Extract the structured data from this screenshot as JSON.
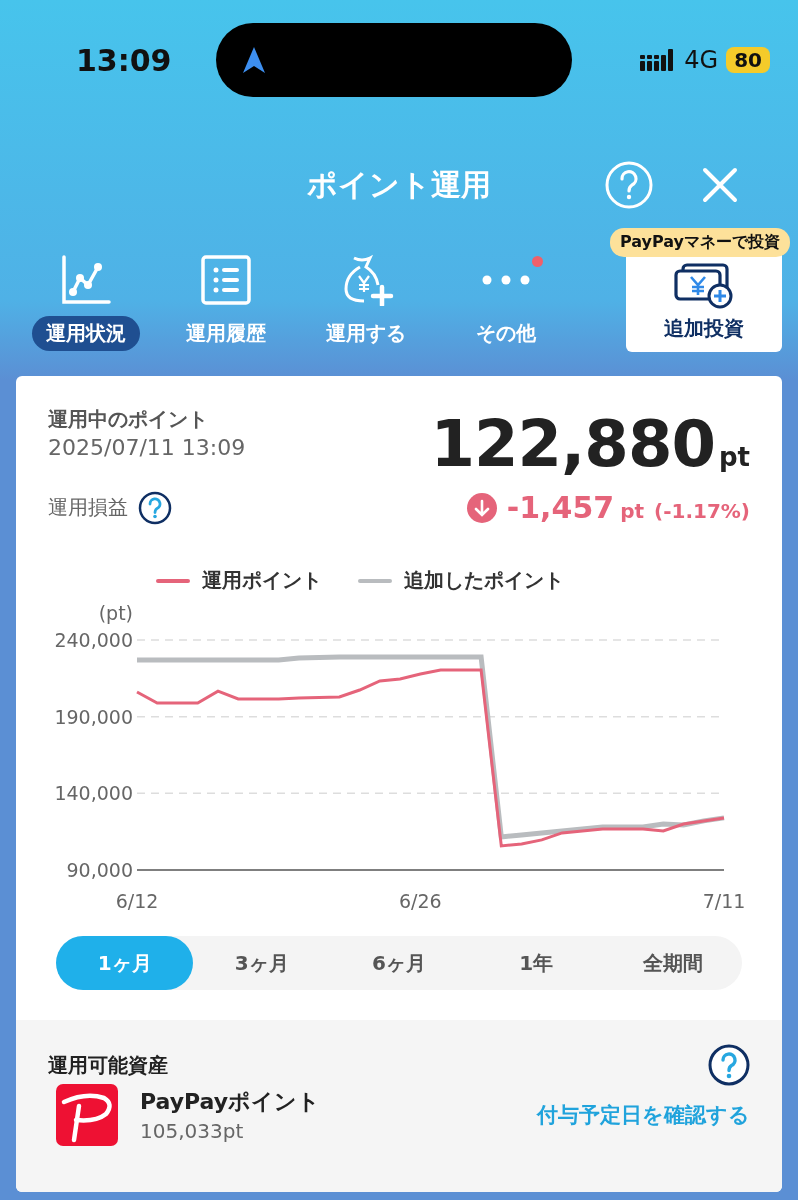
{
  "status_bar": {
    "time": "13:09",
    "network": "4G",
    "battery": "80"
  },
  "header": {
    "title": "ポイント運用"
  },
  "tabs": [
    {
      "label": "運用状況",
      "selected": true,
      "dot": false
    },
    {
      "label": "運用履歴",
      "selected": false,
      "dot": false
    },
    {
      "label": "運用する",
      "selected": false,
      "dot": false
    },
    {
      "label": "その他",
      "selected": false,
      "dot": true
    }
  ],
  "extra_action": {
    "label": "追加投資",
    "tooltip": "PayPayマネーで投資"
  },
  "summary": {
    "label": "運用中のポイント",
    "timestamp": "2025/07/11 13:09",
    "total": "122,880",
    "total_unit": "pt",
    "pl_label": "運用損益",
    "change": "-1,457",
    "change_unit": "pt",
    "change_pct": "(-1.17%)"
  },
  "chart_data": {
    "type": "line",
    "ylabel": "(pt)",
    "categories": [
      "6/12",
      null,
      null,
      null,
      null,
      null,
      null,
      null,
      null,
      null,
      null,
      null,
      null,
      null,
      "6/26",
      null,
      null,
      null,
      null,
      null,
      null,
      null,
      null,
      null,
      null,
      null,
      null,
      null,
      null,
      "7/11"
    ],
    "ylim": [
      90000,
      240000
    ],
    "yticks": [
      {
        "value": 90000,
        "label": "90,000"
      },
      {
        "value": 140000,
        "label": "140,000"
      },
      {
        "value": 190000,
        "label": "190,000"
      },
      {
        "value": 240000,
        "label": "240,000"
      }
    ],
    "series": [
      {
        "name": "運用ポイント",
        "color": "#e5647a",
        "values": [
          206100,
          198900,
          198900,
          198900,
          206700,
          201500,
          201500,
          201500,
          202200,
          202500,
          202800,
          207400,
          213300,
          214600,
          217800,
          220400,
          220400,
          220400,
          105700,
          107000,
          109600,
          114200,
          115500,
          116800,
          116800,
          116800,
          115500,
          120000,
          122000,
          124000
        ]
      },
      {
        "name": "追加したポイント",
        "color": "#b9bcbf",
        "values": [
          227000,
          227000,
          227000,
          227000,
          227000,
          227000,
          227000,
          227000,
          228300,
          228600,
          229000,
          229000,
          229000,
          229000,
          229000,
          229000,
          229000,
          229000,
          111600,
          112900,
          114200,
          115500,
          116800,
          118100,
          118100,
          118100,
          120000,
          119400,
          122000,
          124000
        ]
      }
    ]
  },
  "periods": [
    {
      "label": "1ヶ月",
      "selected": true
    },
    {
      "label": "3ヶ月",
      "selected": false
    },
    {
      "label": "6ヶ月",
      "selected": false
    },
    {
      "label": "1年",
      "selected": false
    },
    {
      "label": "全期間",
      "selected": false
    }
  ],
  "assets": {
    "title": "運用可能資産",
    "items": [
      {
        "name": "PayPayポイント",
        "amount": "105,033pt"
      }
    ],
    "link": "付与予定日を確認する"
  }
}
